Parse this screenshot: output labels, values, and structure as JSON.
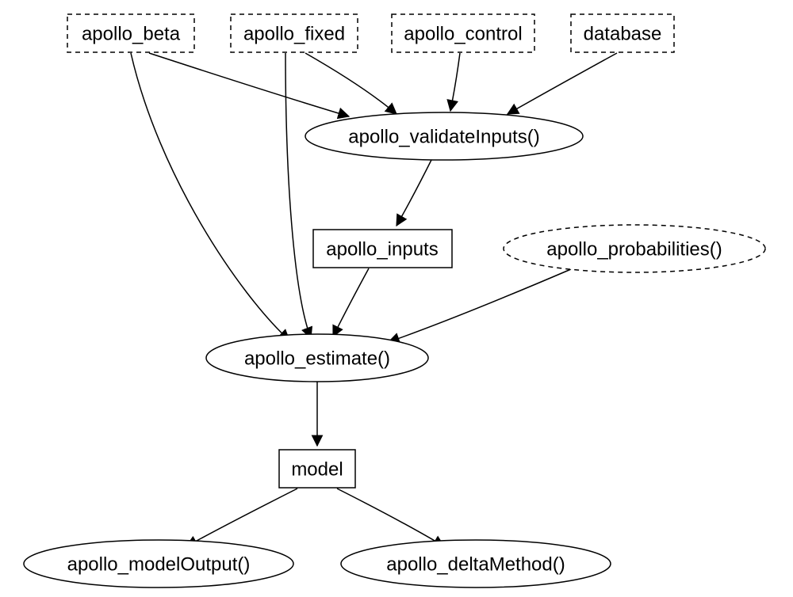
{
  "nodes": {
    "beta": {
      "label": "apollo_beta"
    },
    "fixed": {
      "label": "apollo_fixed"
    },
    "control": {
      "label": "apollo_control"
    },
    "database": {
      "label": "database"
    },
    "validate": {
      "label": "apollo_validateInputs()"
    },
    "inputs": {
      "label": "apollo_inputs"
    },
    "probabilities": {
      "label": "apollo_probabilities()"
    },
    "estimate": {
      "label": "apollo_estimate()"
    },
    "model": {
      "label": "model"
    },
    "modeloutput": {
      "label": "apollo_modelOutput()"
    },
    "deltamethod": {
      "label": "apollo_deltaMethod()"
    }
  },
  "edges": [
    [
      "beta",
      "validate"
    ],
    [
      "fixed",
      "validate"
    ],
    [
      "control",
      "validate"
    ],
    [
      "database",
      "validate"
    ],
    [
      "beta",
      "estimate"
    ],
    [
      "fixed",
      "estimate"
    ],
    [
      "validate",
      "inputs"
    ],
    [
      "inputs",
      "estimate"
    ],
    [
      "probabilities",
      "estimate"
    ],
    [
      "estimate",
      "model"
    ],
    [
      "model",
      "modeloutput"
    ],
    [
      "model",
      "deltamethod"
    ]
  ]
}
